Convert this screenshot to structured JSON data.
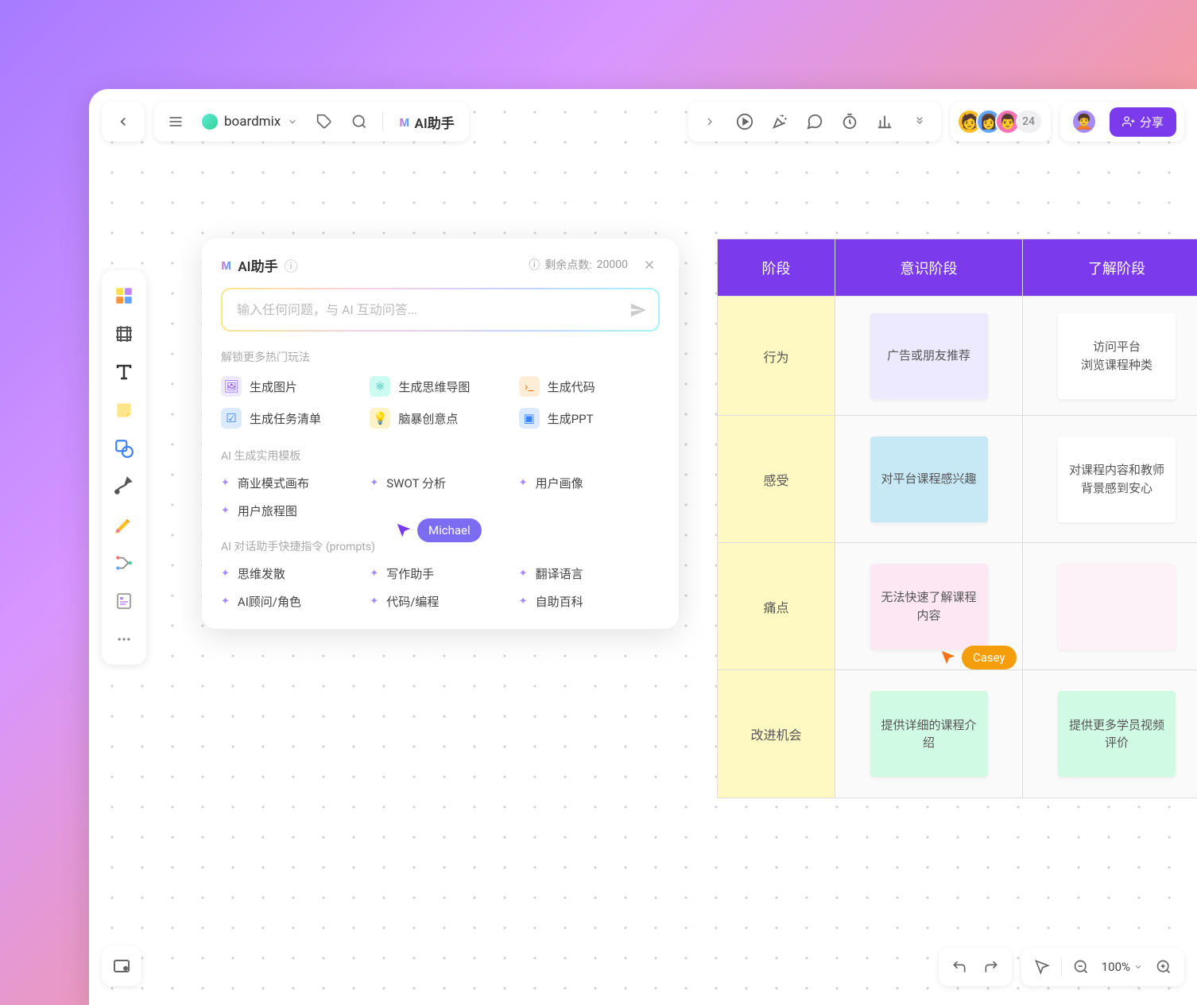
{
  "board": {
    "name": "boardmix"
  },
  "ai_button": "AI助手",
  "avatars": {
    "count": "24"
  },
  "share": "分享",
  "ai_panel": {
    "title": "AI助手",
    "points_label": "剩余点数:",
    "points": "20000",
    "placeholder": "输入任何问题，与 AI 互动问答...",
    "section1": "解锁更多热门玩法",
    "items1": [
      "生成图片",
      "生成思维导图",
      "生成代码",
      "生成任务清单",
      "脑暴创意点",
      "生成PPT"
    ],
    "section2": "AI 生成实用模板",
    "items2": [
      "商业模式画布",
      "SWOT 分析",
      "用户画像",
      "用户旅程图"
    ],
    "section3": "AI 对话助手快捷指令 (prompts)",
    "items3": [
      "思维发散",
      "写作助手",
      "翻译语言",
      "AI顾问/角色",
      "代码/编程",
      "自助百科"
    ]
  },
  "table": {
    "headers": [
      "阶段",
      "意识阶段",
      "了解阶段"
    ],
    "rows": [
      {
        "label": "行为",
        "c1": "广告或朋友推荐",
        "c2": "访问平台\n浏览课程种类",
        "s1": "purple",
        "s2": "white"
      },
      {
        "label": "感受",
        "c1": "对平台课程感兴趣",
        "c2": "对课程内容和教师背景感到安心",
        "s1": "blue",
        "s2": "white"
      },
      {
        "label": "痛点",
        "c1": "无法快速了解课程内容",
        "c2": "",
        "s1": "pink",
        "s2": "lightpink"
      },
      {
        "label": "改进机会",
        "c1": "提供详细的课程介绍",
        "c2": "提供更多学员视频评价",
        "s1": "green",
        "s2": "green"
      }
    ]
  },
  "cursors": {
    "michael": "Michael",
    "casey": "Casey"
  },
  "zoom": "100%"
}
